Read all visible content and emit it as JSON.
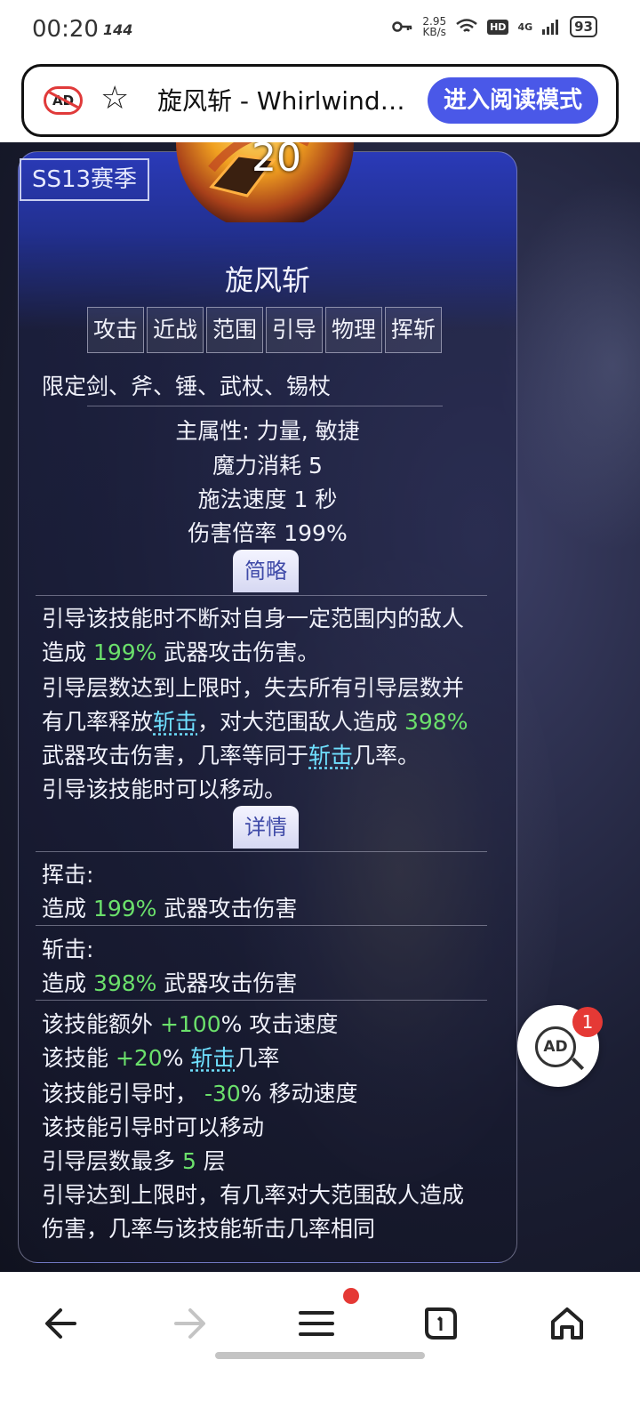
{
  "status_bar": {
    "time": "00:20",
    "refresh_rate": "144",
    "speed_value": "2.95",
    "speed_unit": "KB/s",
    "hd_label": "HD",
    "network": "4G",
    "battery": "93"
  },
  "url_bar": {
    "ad_block_label": "AD",
    "title": "旋风斩 - Whirlwind - 流放之路",
    "reader_mode_label": "进入阅读模式"
  },
  "skill": {
    "season_badge": "SS13赛季",
    "level": "20",
    "name": "旋风斩",
    "tags": [
      "攻击",
      "近战",
      "范围",
      "引导",
      "物理",
      "挥斩"
    ],
    "restriction": "限定剑、斧、锤、武杖、锡杖",
    "stats": {
      "main_attr": "主属性:  力量, 敏捷",
      "mana_cost": "魔力消耗 5",
      "cast_speed": "施法速度 1 秒",
      "damage_multiplier": "伤害倍率 199%"
    },
    "summary_tab": "简略",
    "summary": {
      "l1": "引导该技能时不断对自身一定范围内的敌人",
      "l2a": "造成 ",
      "l2b": "199%",
      "l2c": " 武器攻击伤害。",
      "l3": "引导层数达到上限时，失去所有引导层数并",
      "l4a": "有几率释放",
      "l4b": "斩击",
      "l4c": "，对大范围敌人造成 ",
      "l4d": "398%",
      "l5a": "武器攻击伤害，几率等同于",
      "l5b": "斩击",
      "l5c": "几率。",
      "l6": "引导该技能时可以移动。"
    },
    "details_tab": "详情",
    "details": {
      "slash_title": "挥击:",
      "slash_a": "造成 ",
      "slash_b": "199%",
      "slash_c": " 武器攻击伤害",
      "strike_title": "斩击:",
      "strike_a": "造成 ",
      "strike_b": "398%",
      "strike_c": " 武器攻击伤害",
      "m1a": "该技能额外 ",
      "m1b": "+100",
      "m1c": "% 攻击速度",
      "m2a": "该技能 ",
      "m2b": "+20",
      "m2c": "% ",
      "m2d": "斩击",
      "m2e": "几率",
      "m3a": "该技能引导时， ",
      "m3b": "-30",
      "m3c": "% 移动速度",
      "m4": "该技能引导时可以移动",
      "m5a": "引导层数最多 ",
      "m5b": "5",
      "m5c": " 层",
      "m6": "引导达到上限时，有几率对大范围敌人造成",
      "m7": "伤害，几率与该技能斩击几率相同"
    }
  },
  "ad_float": {
    "label": "AD",
    "count": "1"
  },
  "colors": {
    "accent": "#4a58e8",
    "highlight_green": "#6be06b",
    "link_cyan": "#6fe0ff",
    "badge_red": "#e53935"
  },
  "nav": {
    "icons": [
      "back-arrow-icon",
      "forward-arrow-icon",
      "menu-icon",
      "tabs-icon",
      "home-icon"
    ]
  }
}
